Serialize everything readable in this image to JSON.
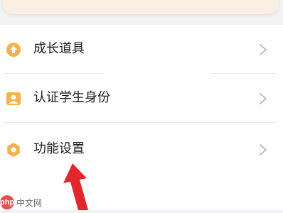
{
  "menu": {
    "items": [
      {
        "label": "成长道具",
        "icon": "growth-prop-icon"
      },
      {
        "label": "认证学生身份",
        "icon": "student-id-icon"
      },
      {
        "label": "功能设置",
        "icon": "settings-gear-icon"
      }
    ]
  },
  "watermark": {
    "badge": "php",
    "text": "中文网"
  },
  "colors": {
    "icon_accent": "#f3b24b",
    "annotation_arrow": "#e3262b",
    "watermark_accent": "#e4504d"
  }
}
